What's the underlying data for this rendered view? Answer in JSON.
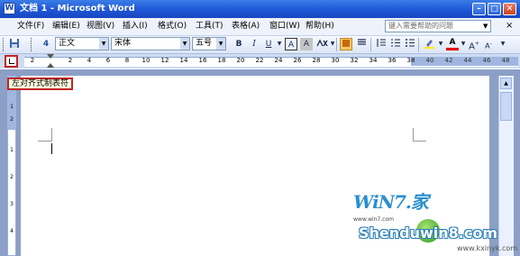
{
  "window": {
    "title": "文档 1 - Microsoft Word",
    "app_icon": "W",
    "buttons": {
      "minimize": "–",
      "maximize": "□",
      "close": "✕"
    }
  },
  "menu": {
    "items": [
      "文件(F)",
      "编辑(E)",
      "视图(V)",
      "插入(I)",
      "格式(O)",
      "工具(T)",
      "表格(A)",
      "窗口(W)",
      "帮助(H)"
    ],
    "help_placeholder": "键入需要帮助的问题",
    "close_glyph": "×"
  },
  "toolbar": {
    "style": "正文",
    "font": "宋体",
    "size": "五号",
    "style_prefix": "4",
    "bold": "B",
    "italic": "I",
    "underline": "U",
    "char_border": "A",
    "char_shade": "A",
    "font_color": "A",
    "grow_font": "A",
    "shrink_font": "A",
    "icons": [
      "save-icon",
      "style-icon",
      "bold-icon",
      "italic-icon",
      "underline-icon",
      "align-left-icon",
      "justify-icon",
      "numbering-icon",
      "bullets-icon",
      "indent-icon",
      "highlight-icon",
      "font-color-icon"
    ]
  },
  "ruler": {
    "tab_selector_tooltip": "左对齐式制表符",
    "numbers": [
      "2",
      "2",
      "4",
      "6",
      "8",
      "10",
      "12",
      "14",
      "16",
      "18",
      "20",
      "22",
      "24",
      "26",
      "28",
      "30",
      "32",
      "34",
      "36",
      "38",
      "40",
      "42",
      "44",
      "46",
      "48"
    ],
    "vertical_numbers": [
      "1",
      "2",
      "1",
      "2",
      "3",
      "4"
    ]
  },
  "watermark": {
    "brand": "WiN7.家",
    "subtitle": "www.win7.com",
    "site": "Shenduwin8.com",
    "url": "www.kxinyk.com"
  },
  "colors": {
    "title_bar": "#1f56d6",
    "highlight_box": "#c22425",
    "menu_bg": "#eef2fb",
    "doc_bg": "#8c9fc6"
  }
}
